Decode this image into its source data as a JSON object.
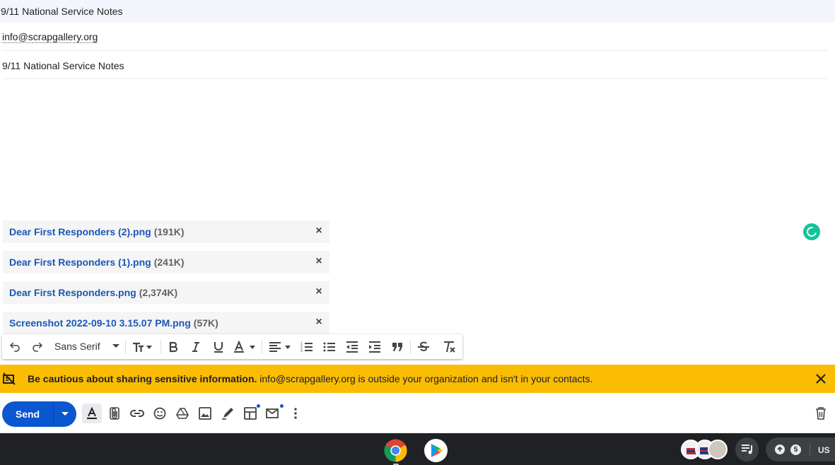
{
  "window": {
    "title": "9/11 National Service Notes"
  },
  "compose": {
    "to": "info@scrapgallery.org",
    "subject": "9/11 National Service Notes"
  },
  "attachments": [
    {
      "name": "Dear First Responders (2).png",
      "size": "(191K)"
    },
    {
      "name": "Dear First Responders (1).png",
      "size": "(241K)"
    },
    {
      "name": "Dear First Responders.png",
      "size": "(2,374K)"
    },
    {
      "name": "Screenshot 2022-09-10 3.15.07 PM.png",
      "size": "(57K)"
    }
  ],
  "attachment_remove_glyph": "×",
  "formatting": {
    "font": "Sans Serif",
    "buttons": [
      "undo-icon",
      "redo-icon",
      "text-size-icon",
      "bold-icon",
      "italic-icon",
      "underline-icon",
      "text-color-icon",
      "align-icon",
      "numbered-list-icon",
      "bulleted-list-icon",
      "indent-less-icon",
      "indent-more-icon",
      "quote-icon",
      "strikethrough-icon",
      "remove-formatting-icon"
    ]
  },
  "warning": {
    "bold": "Be cautious about sharing sensitive information.",
    "text": " info@scrapgallery.org is outside your organization and isn't in your contacts.",
    "color": "#fbbc04"
  },
  "actions": {
    "send_label": "Send",
    "icons": [
      "formatting-toggle-icon",
      "attach-file-icon",
      "insert-link-icon",
      "emoji-icon",
      "drive-icon",
      "insert-photo-icon",
      "signature-icon",
      "layouts-icon",
      "confidential-mode-icon",
      "more-options-icon",
      "discard-draft-icon"
    ]
  },
  "taskbar": {
    "apps": [
      "chrome-icon",
      "play-store-icon"
    ],
    "notification_count": "5",
    "locale": "US"
  },
  "colors": {
    "accent": "#0b57d0",
    "link": "#1a57b8",
    "taskbar": "#202124"
  }
}
